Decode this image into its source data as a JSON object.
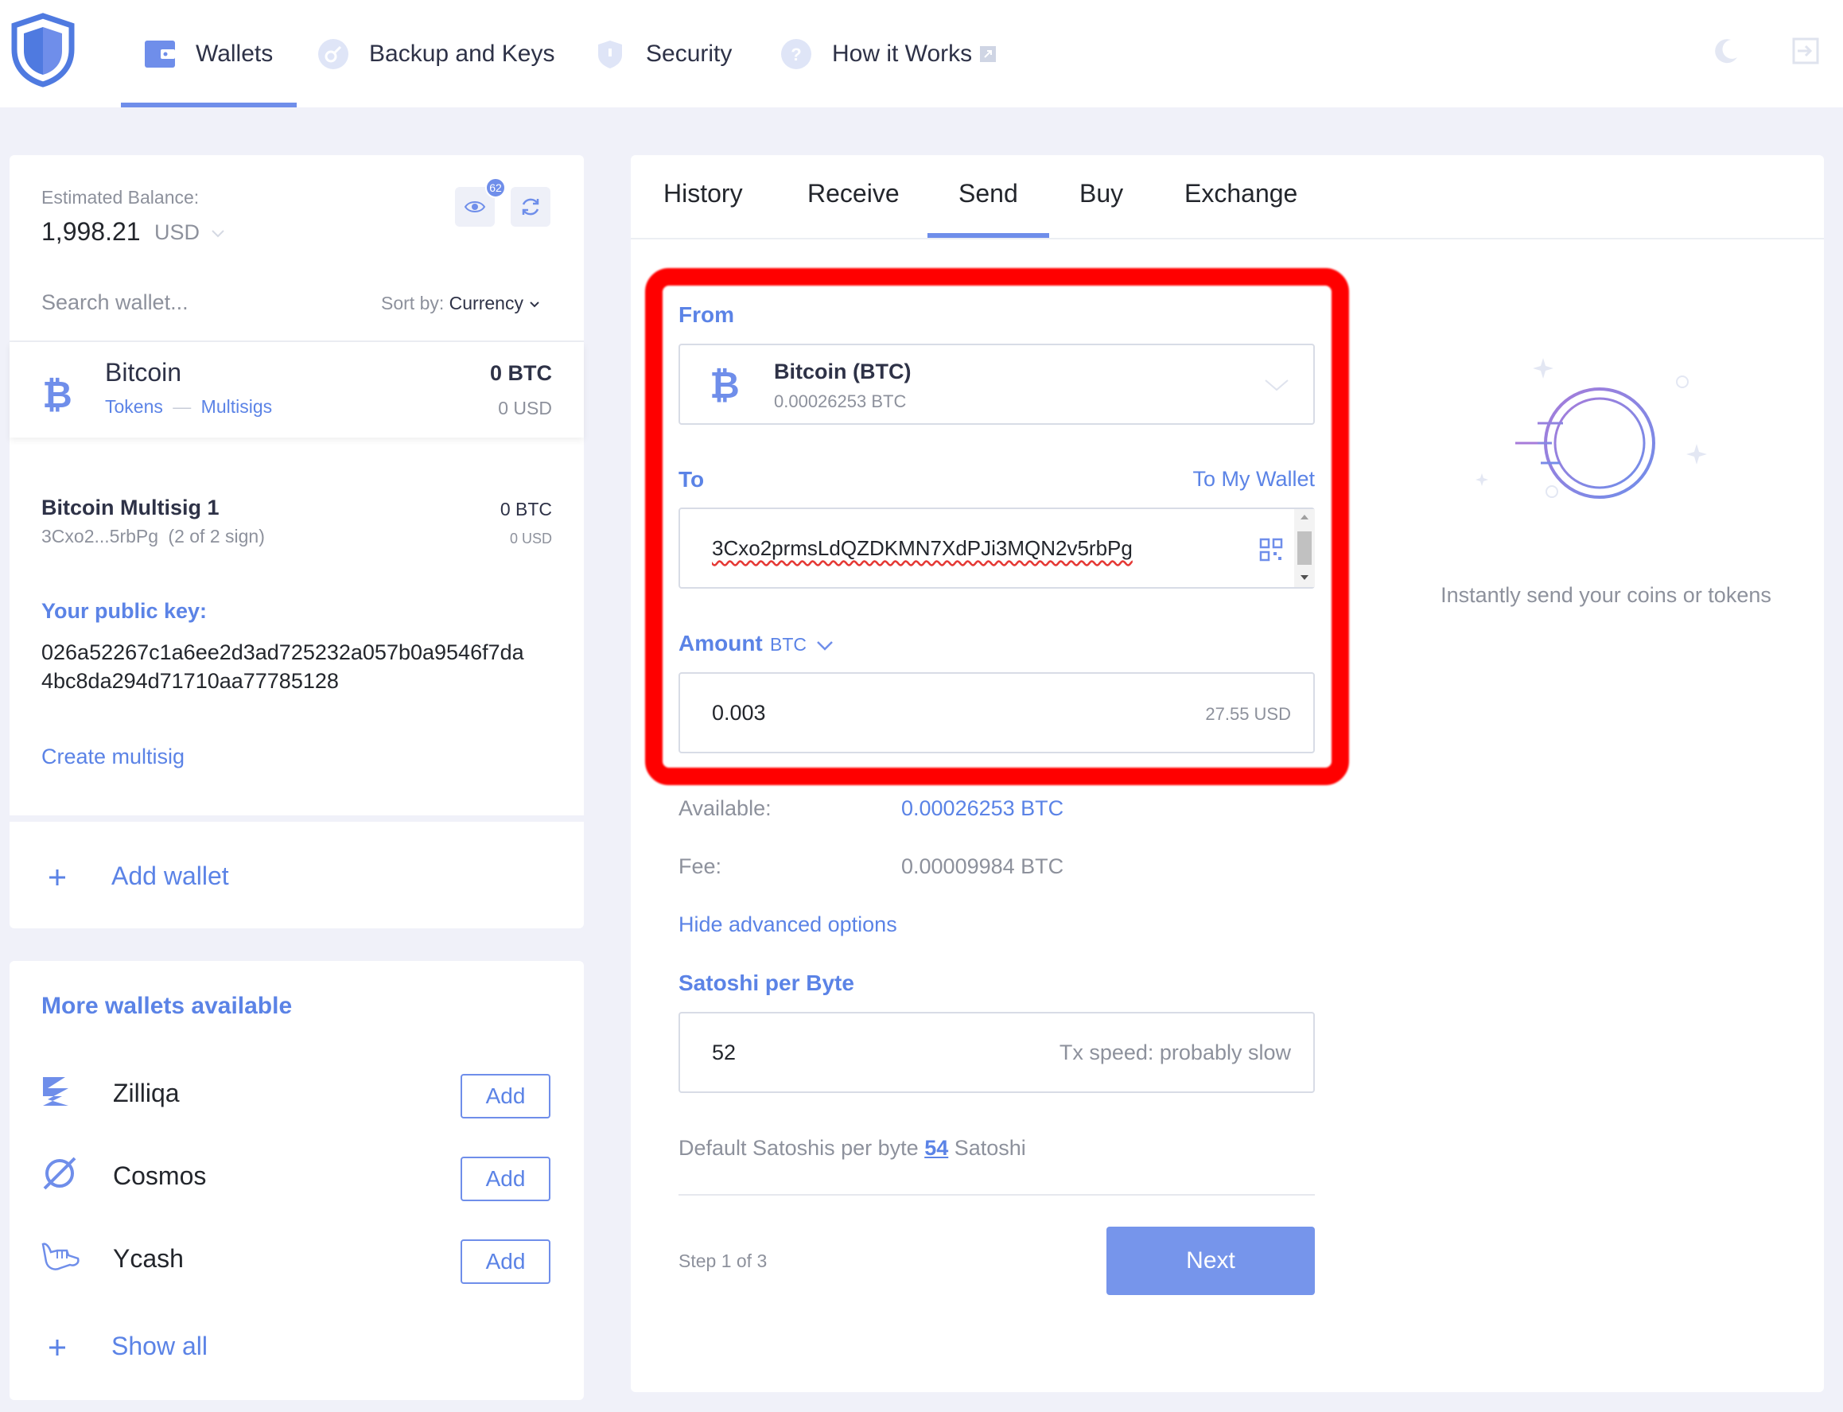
{
  "nav": {
    "items": [
      {
        "label": "Wallets",
        "icon": "wallet-icon"
      },
      {
        "label": "Backup and Keys",
        "icon": "key-icon"
      },
      {
        "label": "Security",
        "icon": "shield-icon"
      },
      {
        "label": "How it Works",
        "icon": "question-icon"
      }
    ],
    "active": "Wallets"
  },
  "balance": {
    "label": "Estimated Balance:",
    "amount": "1,998.21",
    "currency": "USD",
    "badge_count": "62"
  },
  "search": {
    "placeholder": "Search wallet...",
    "sort_label": "Sort by:",
    "sort_value": "Currency"
  },
  "wallet": {
    "name": "Bitcoin",
    "link1": "Tokens",
    "link2": "Multisigs",
    "amount": "0 BTC",
    "usd": "0 USD"
  },
  "multisig": {
    "name": "Bitcoin Multisig 1",
    "address": "3Cxo2...5rbPg",
    "sign": "(2 of 2 sign)",
    "amount": "0 BTC",
    "usd": "0 USD",
    "pubkey_label": "Your public key:",
    "pubkey_line1": "026a52267c1a6ee2d3ad725232a057b0a9546f7da",
    "pubkey_line2": "4bc8da294d71710aa77785128",
    "create_link": "Create multisig"
  },
  "add_wallet": {
    "label": "Add wallet"
  },
  "more_wallets": {
    "title": "More wallets available",
    "items": [
      {
        "name": "Zilliqa",
        "button": "Add",
        "icon": "zilliqa-icon"
      },
      {
        "name": "Cosmos",
        "button": "Add",
        "icon": "cosmos-icon"
      },
      {
        "name": "Ycash",
        "button": "Add",
        "icon": "ycash-icon"
      }
    ],
    "show_all": "Show all"
  },
  "tabs": [
    "History",
    "Receive",
    "Send",
    "Buy",
    "Exchange"
  ],
  "active_tab": "Send",
  "send": {
    "from_label": "From",
    "from_coin": "Bitcoin (BTC)",
    "from_balance": "0.00026253 BTC",
    "to_label": "To",
    "to_my_wallet": "To My Wallet",
    "to_address": "3Cxo2prmsLdQZDKMN7XdPJi3MQN2v5rbPg",
    "amount_label": "Amount",
    "amount_unit": "BTC",
    "amount_value": "0.003",
    "amount_usd": "27.55 USD",
    "available_label": "Available:",
    "available_value": "0.00026253 BTC",
    "fee_label": "Fee:",
    "fee_value": "0.00009984 BTC",
    "advanced_link": "Hide advanced options",
    "spb_label": "Satoshi per Byte",
    "spb_value": "52",
    "tx_speed": "Tx speed: probably slow",
    "default_prefix": "Default Satoshis per byte",
    "default_value": "54",
    "default_suffix": "Satoshi",
    "step": "Step 1 of 3",
    "next": "Next"
  },
  "promo": {
    "text": "Instantly send your coins or tokens"
  },
  "colors": {
    "accent": "#6f8eea",
    "link": "#5b83e6",
    "highlight": "#ff0000",
    "background": "#f0f1f9"
  }
}
